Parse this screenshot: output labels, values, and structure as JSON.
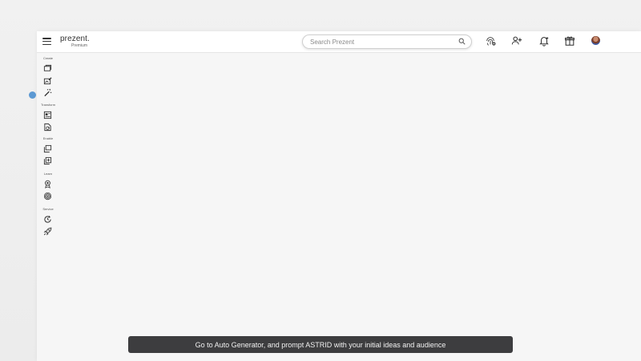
{
  "header": {
    "brand_name": "prezent.",
    "brand_tier": "Premium",
    "search_placeholder": "Search Prezent"
  },
  "sidebar": {
    "sections": [
      {
        "label": "Create",
        "items": [
          {
            "icon": "slides-stack-icon"
          },
          {
            "icon": "image-edit-icon"
          },
          {
            "icon": "magic-wand-icon"
          }
        ]
      },
      {
        "label": "Transform",
        "items": [
          {
            "icon": "template-convert-icon"
          },
          {
            "icon": "document-refresh-icon"
          }
        ]
      },
      {
        "label": "Enable",
        "items": [
          {
            "icon": "library-stack-icon"
          },
          {
            "icon": "add-collection-icon"
          }
        ]
      },
      {
        "label": "Learn",
        "items": [
          {
            "icon": "award-badge-icon"
          },
          {
            "icon": "fingerprint-icon"
          }
        ]
      },
      {
        "label": "Service",
        "items": [
          {
            "icon": "clock-refresh-icon"
          },
          {
            "icon": "rocket-icon"
          }
        ]
      }
    ]
  },
  "topbar_icons": [
    "fingerprint-add-icon",
    "add-user-icon",
    "notification-bell-icon",
    "gift-icon",
    "user-avatar"
  ],
  "caption": {
    "text": "Go to Auto Generator, and prompt ASTRID with your initial ideas and audience"
  },
  "colors": {
    "background": "#f6f6f6",
    "caption_bg": "#3d3d3f",
    "cursor_dot": "#4b8fcf"
  }
}
